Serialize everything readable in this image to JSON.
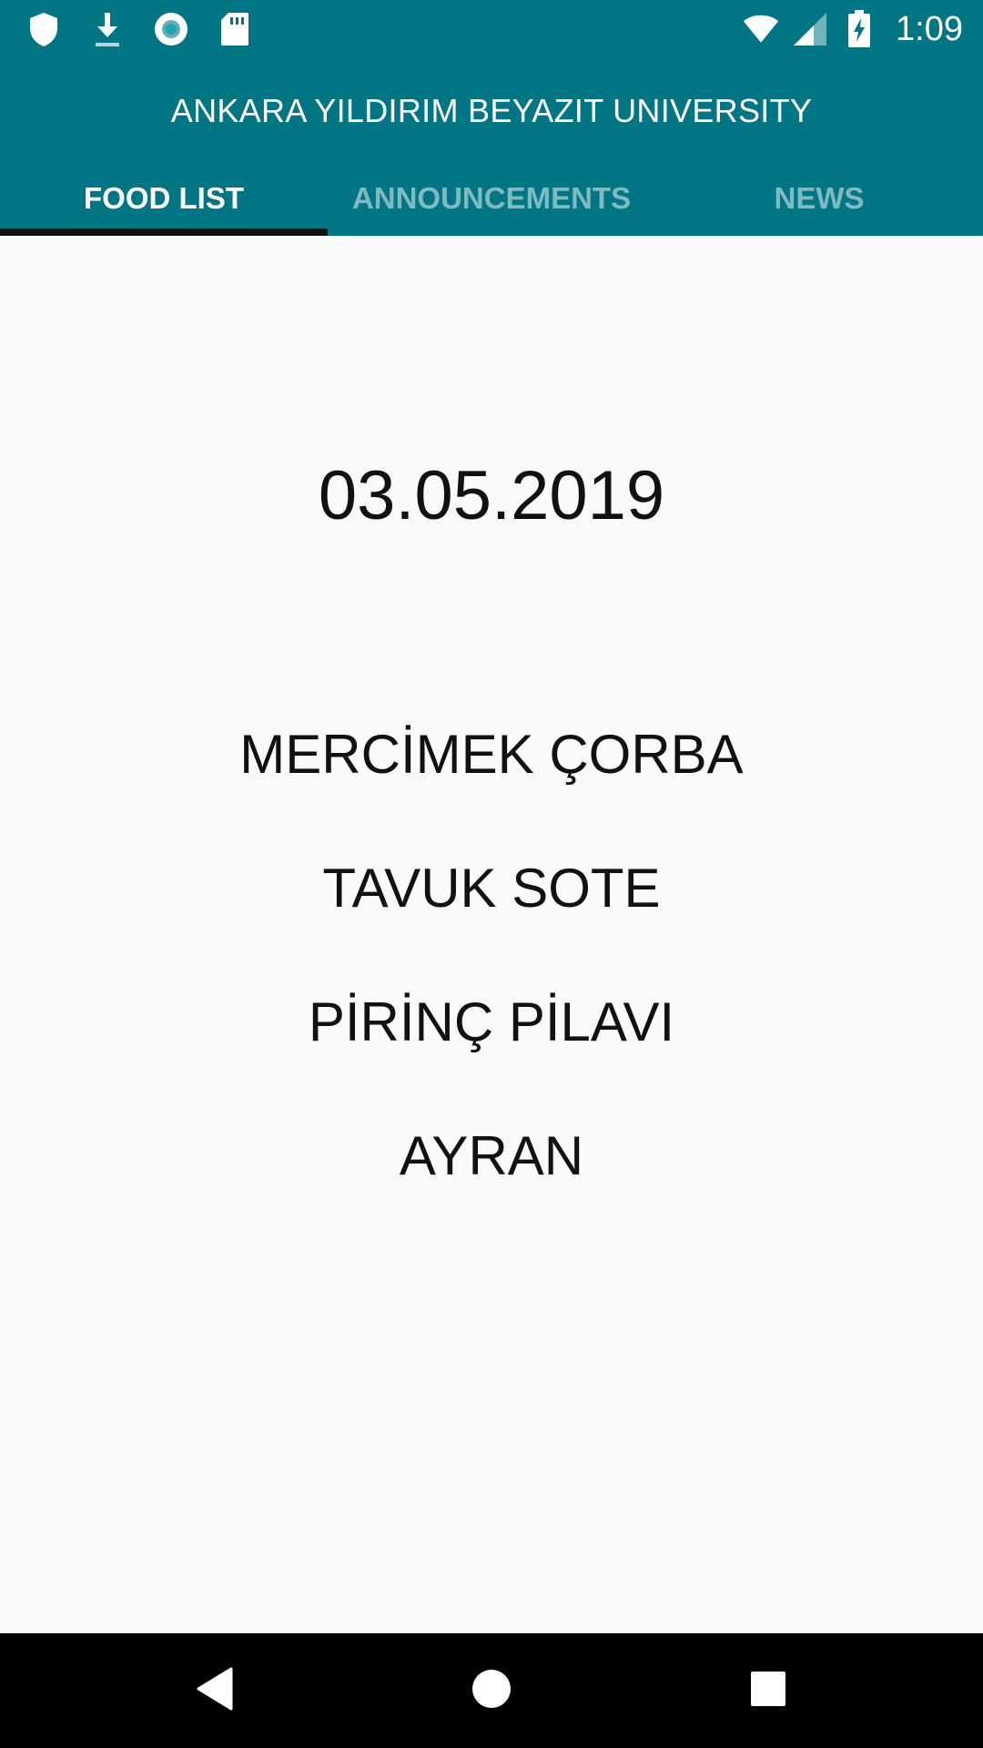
{
  "status_bar": {
    "time": "1:09",
    "icons": [
      "shield-icon",
      "download-icon",
      "sync-circle-icon",
      "sd-card-icon",
      "wifi-icon",
      "cell-signal-icon",
      "battery-charging-icon"
    ]
  },
  "app_bar": {
    "title": "ANKARA YILDIRIM BEYAZIT UNIVERSITY",
    "color": "#007584"
  },
  "tabs": [
    {
      "label": "FOOD LIST",
      "active": true
    },
    {
      "label": "ANNOUNCEMENTS",
      "active": false
    },
    {
      "label": "NEWS",
      "active": false
    }
  ],
  "food_list": {
    "date": "03.05.2019",
    "items": [
      "MERCİMEK ÇORBA",
      "TAVUK SOTE",
      "PİRİNÇ PİLAVI",
      "AYRAN"
    ]
  },
  "nav_bar": {
    "buttons": [
      "back-icon",
      "home-icon",
      "recents-icon"
    ]
  }
}
